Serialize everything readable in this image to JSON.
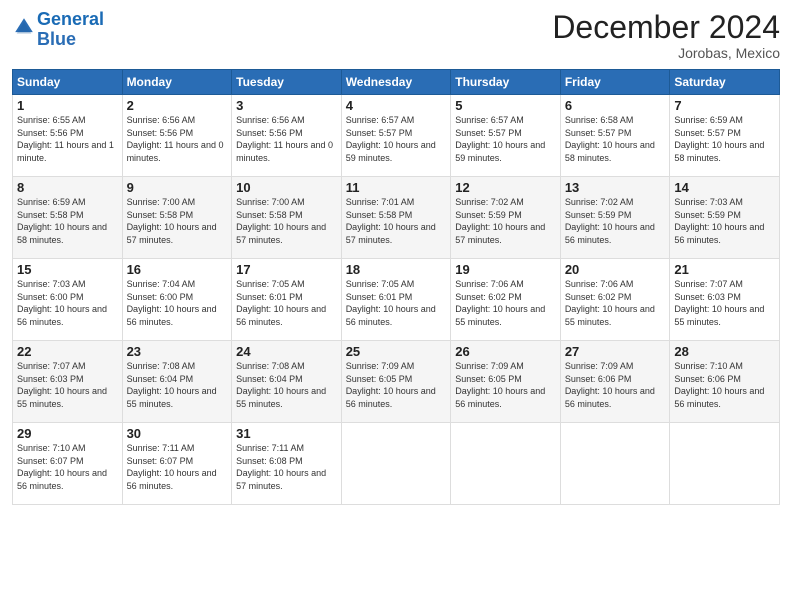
{
  "logo": {
    "text_general": "General",
    "text_blue": "Blue"
  },
  "header": {
    "month": "December 2024",
    "location": "Jorobas, Mexico"
  },
  "weekdays": [
    "Sunday",
    "Monday",
    "Tuesday",
    "Wednesday",
    "Thursday",
    "Friday",
    "Saturday"
  ],
  "weeks": [
    [
      {
        "day": "1",
        "sunrise": "6:55 AM",
        "sunset": "5:56 PM",
        "daylight": "11 hours and 1 minute."
      },
      {
        "day": "2",
        "sunrise": "6:56 AM",
        "sunset": "5:56 PM",
        "daylight": "11 hours and 0 minutes."
      },
      {
        "day": "3",
        "sunrise": "6:56 AM",
        "sunset": "5:56 PM",
        "daylight": "11 hours and 0 minutes."
      },
      {
        "day": "4",
        "sunrise": "6:57 AM",
        "sunset": "5:57 PM",
        "daylight": "10 hours and 59 minutes."
      },
      {
        "day": "5",
        "sunrise": "6:57 AM",
        "sunset": "5:57 PM",
        "daylight": "10 hours and 59 minutes."
      },
      {
        "day": "6",
        "sunrise": "6:58 AM",
        "sunset": "5:57 PM",
        "daylight": "10 hours and 58 minutes."
      },
      {
        "day": "7",
        "sunrise": "6:59 AM",
        "sunset": "5:57 PM",
        "daylight": "10 hours and 58 minutes."
      }
    ],
    [
      {
        "day": "8",
        "sunrise": "6:59 AM",
        "sunset": "5:58 PM",
        "daylight": "10 hours and 58 minutes."
      },
      {
        "day": "9",
        "sunrise": "7:00 AM",
        "sunset": "5:58 PM",
        "daylight": "10 hours and 57 minutes."
      },
      {
        "day": "10",
        "sunrise": "7:00 AM",
        "sunset": "5:58 PM",
        "daylight": "10 hours and 57 minutes."
      },
      {
        "day": "11",
        "sunrise": "7:01 AM",
        "sunset": "5:58 PM",
        "daylight": "10 hours and 57 minutes."
      },
      {
        "day": "12",
        "sunrise": "7:02 AM",
        "sunset": "5:59 PM",
        "daylight": "10 hours and 57 minutes."
      },
      {
        "day": "13",
        "sunrise": "7:02 AM",
        "sunset": "5:59 PM",
        "daylight": "10 hours and 56 minutes."
      },
      {
        "day": "14",
        "sunrise": "7:03 AM",
        "sunset": "5:59 PM",
        "daylight": "10 hours and 56 minutes."
      }
    ],
    [
      {
        "day": "15",
        "sunrise": "7:03 AM",
        "sunset": "6:00 PM",
        "daylight": "10 hours and 56 minutes."
      },
      {
        "day": "16",
        "sunrise": "7:04 AM",
        "sunset": "6:00 PM",
        "daylight": "10 hours and 56 minutes."
      },
      {
        "day": "17",
        "sunrise": "7:05 AM",
        "sunset": "6:01 PM",
        "daylight": "10 hours and 56 minutes."
      },
      {
        "day": "18",
        "sunrise": "7:05 AM",
        "sunset": "6:01 PM",
        "daylight": "10 hours and 56 minutes."
      },
      {
        "day": "19",
        "sunrise": "7:06 AM",
        "sunset": "6:02 PM",
        "daylight": "10 hours and 55 minutes."
      },
      {
        "day": "20",
        "sunrise": "7:06 AM",
        "sunset": "6:02 PM",
        "daylight": "10 hours and 55 minutes."
      },
      {
        "day": "21",
        "sunrise": "7:07 AM",
        "sunset": "6:03 PM",
        "daylight": "10 hours and 55 minutes."
      }
    ],
    [
      {
        "day": "22",
        "sunrise": "7:07 AM",
        "sunset": "6:03 PM",
        "daylight": "10 hours and 55 minutes."
      },
      {
        "day": "23",
        "sunrise": "7:08 AM",
        "sunset": "6:04 PM",
        "daylight": "10 hours and 55 minutes."
      },
      {
        "day": "24",
        "sunrise": "7:08 AM",
        "sunset": "6:04 PM",
        "daylight": "10 hours and 55 minutes."
      },
      {
        "day": "25",
        "sunrise": "7:09 AM",
        "sunset": "6:05 PM",
        "daylight": "10 hours and 56 minutes."
      },
      {
        "day": "26",
        "sunrise": "7:09 AM",
        "sunset": "6:05 PM",
        "daylight": "10 hours and 56 minutes."
      },
      {
        "day": "27",
        "sunrise": "7:09 AM",
        "sunset": "6:06 PM",
        "daylight": "10 hours and 56 minutes."
      },
      {
        "day": "28",
        "sunrise": "7:10 AM",
        "sunset": "6:06 PM",
        "daylight": "10 hours and 56 minutes."
      }
    ],
    [
      {
        "day": "29",
        "sunrise": "7:10 AM",
        "sunset": "6:07 PM",
        "daylight": "10 hours and 56 minutes."
      },
      {
        "day": "30",
        "sunrise": "7:11 AM",
        "sunset": "6:07 PM",
        "daylight": "10 hours and 56 minutes."
      },
      {
        "day": "31",
        "sunrise": "7:11 AM",
        "sunset": "6:08 PM",
        "daylight": "10 hours and 57 minutes."
      },
      null,
      null,
      null,
      null
    ]
  ]
}
